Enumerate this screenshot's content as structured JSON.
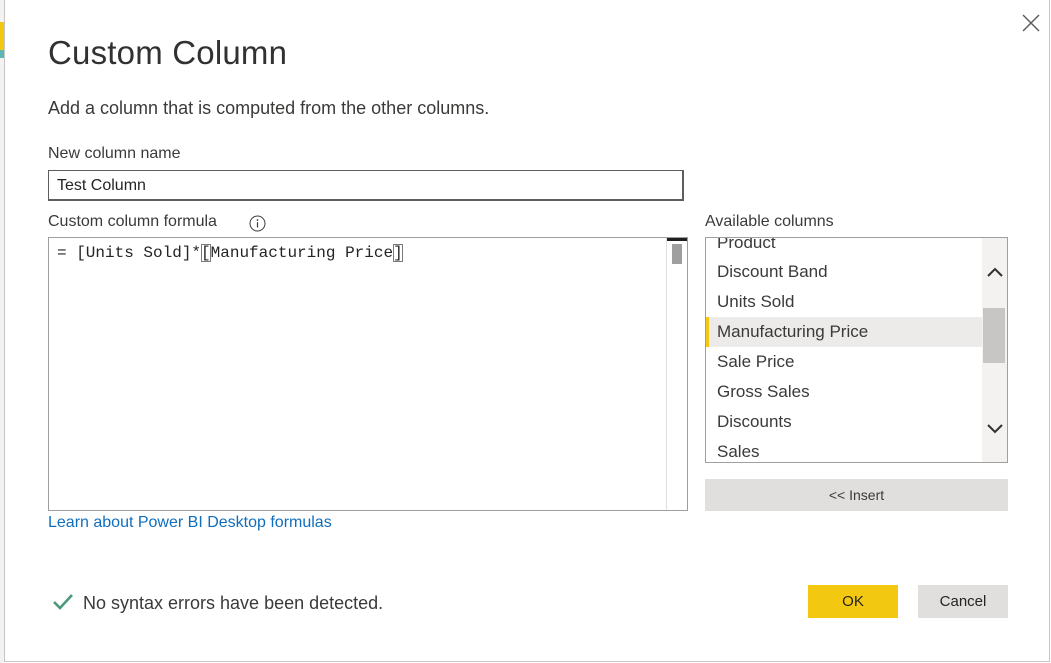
{
  "dialog": {
    "title": "Custom Column",
    "subtitle": "Add a column that is computed from the other columns.",
    "close_icon": "close-icon"
  },
  "column_name": {
    "label": "New column name",
    "value": "Test Column"
  },
  "formula": {
    "label": "Custom column formula",
    "info_icon": "info-icon",
    "prefix": "= [Units Sold]*",
    "highlight_open": "[",
    "middle": "Manufacturing Price",
    "highlight_close": "]"
  },
  "learn_link": "Learn about Power BI Desktop formulas",
  "available_columns": {
    "label": "Available columns",
    "items": [
      {
        "label": "Product",
        "selected": false
      },
      {
        "label": "Discount Band",
        "selected": false
      },
      {
        "label": "Units Sold",
        "selected": false
      },
      {
        "label": "Manufacturing Price",
        "selected": true
      },
      {
        "label": "Sale Price",
        "selected": false
      },
      {
        "label": "Gross Sales",
        "selected": false
      },
      {
        "label": "Discounts",
        "selected": false
      },
      {
        "label": "Sales",
        "selected": false
      }
    ],
    "insert_label": "<< Insert"
  },
  "status": {
    "icon": "checkmark-icon",
    "text": "No syntax errors have been detected."
  },
  "buttons": {
    "ok": "OK",
    "cancel": "Cancel"
  },
  "colors": {
    "accent": "#f2c811",
    "link": "#106ebe",
    "success": "#2e8b57"
  }
}
